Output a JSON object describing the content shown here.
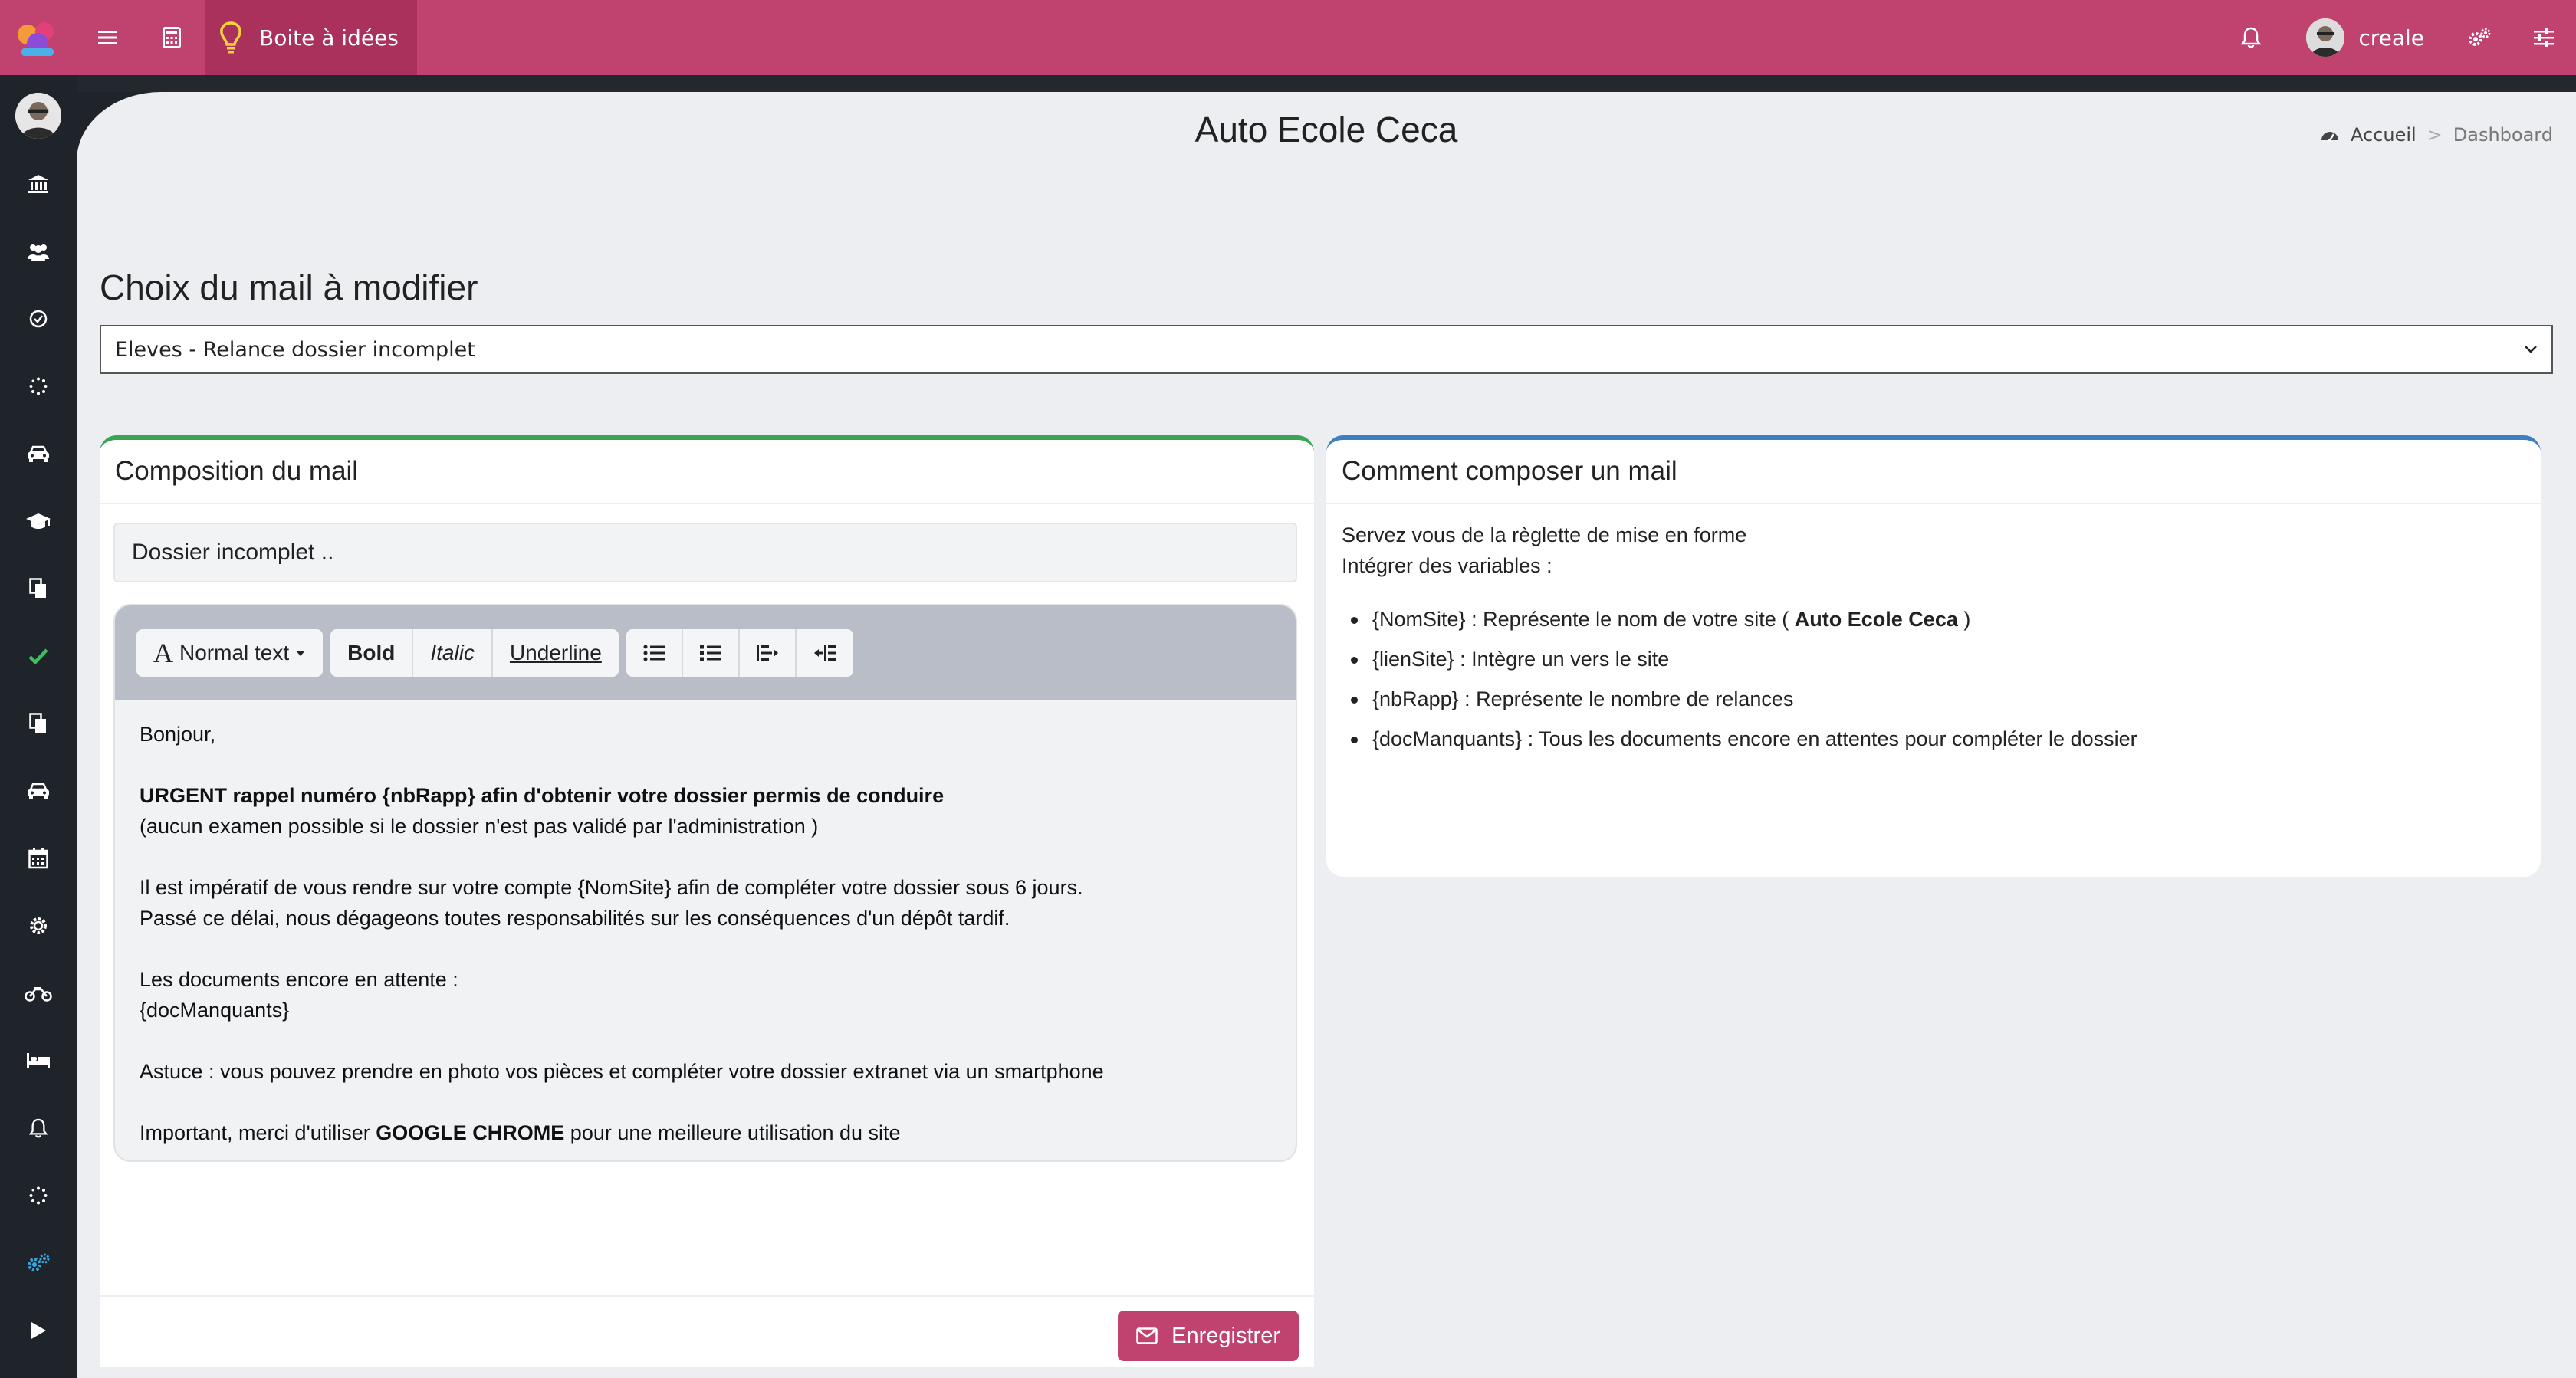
{
  "topbar": {
    "app_tab_label": "Boite à idées",
    "user_name": "creale"
  },
  "page": {
    "title": "Auto Ecole Ceca",
    "breadcrumb": [
      "Accueil",
      ">",
      "Dashboard"
    ]
  },
  "mail_choice": {
    "heading": "Choix du mail à modifier",
    "selected": "Eleves - Relance dossier incomplet"
  },
  "composition": {
    "header": "Composition du mail",
    "subject": "Dossier incomplet ..",
    "toolbar": {
      "format_label": "Normal text",
      "bold_label": "Bold",
      "italic_label": "Italic",
      "underline_label": "Underline"
    },
    "body": {
      "greeting": "Bonjour,",
      "urgent": "URGENT rappel numéro {nbRapp} afin d'obtenir votre dossier permis de conduire",
      "note": "(aucun examen possible si le dossier n'est pas validé par l'administration )",
      "para1": "Il est impératif de vous rendre sur votre compte {NomSite} afin de compléter votre dossier sous 6 jours.",
      "para2": "Passé ce délai, nous dégageons toutes responsabilités sur les conséquences d'un dépôt tardif.",
      "docs_label": "Les documents encore en attente :",
      "docs_var": "{docManquants}",
      "tip": "Astuce : vous pouvez prendre en photo vos pièces et compléter votre dossier extranet via un smartphone",
      "important_pre": "Important, merci d'utiliser",
      "important_bold": "GOOGLE CHROME",
      "important_post": "pour une meilleure utilisation du site"
    },
    "save_label": "Enregistrer"
  },
  "help": {
    "header": "Comment composer un mail",
    "line1": "Servez vous de la règlette de mise en forme",
    "line2": "Intégrer des variables :",
    "items": [
      {
        "pre": "{NomSite} : Représente le nom de votre site (",
        "bold": "Auto Ecole Ceca",
        "post": ")"
      },
      {
        "pre": "{lienSite} : Intègre un vers le site",
        "bold": "",
        "post": ""
      },
      {
        "pre": "{nbRapp} : Représente le nombre de relances",
        "bold": "",
        "post": ""
      },
      {
        "pre": "{docManquants} : Tous les documents encore en attentes pour compléter le dossier",
        "bold": "",
        "post": ""
      }
    ]
  },
  "colors": {
    "brand": "#c0426f",
    "sidebar": "#1f232a",
    "card_left_accent": "#3aa355",
    "card_right_accent": "#3d7fc1"
  },
  "icons": {
    "topbar": [
      "logo-icon",
      "menu-icon",
      "calculator-icon",
      "lightbulb-icon",
      "bell-icon",
      "settings-icon",
      "sliders-icon"
    ],
    "sidebar": [
      "avatar",
      "bank-icon",
      "users-icon",
      "check-circle-icon",
      "spinner-icon",
      "car-icon",
      "graduation-cap-icon",
      "copy-icon",
      "check-icon",
      "copy-icon",
      "car-icon",
      "calendar-icon",
      "gear-icon",
      "motorcycle-icon",
      "bed-icon",
      "bell-icon",
      "spinner-icon",
      "gears-icon",
      "play-icon"
    ]
  }
}
